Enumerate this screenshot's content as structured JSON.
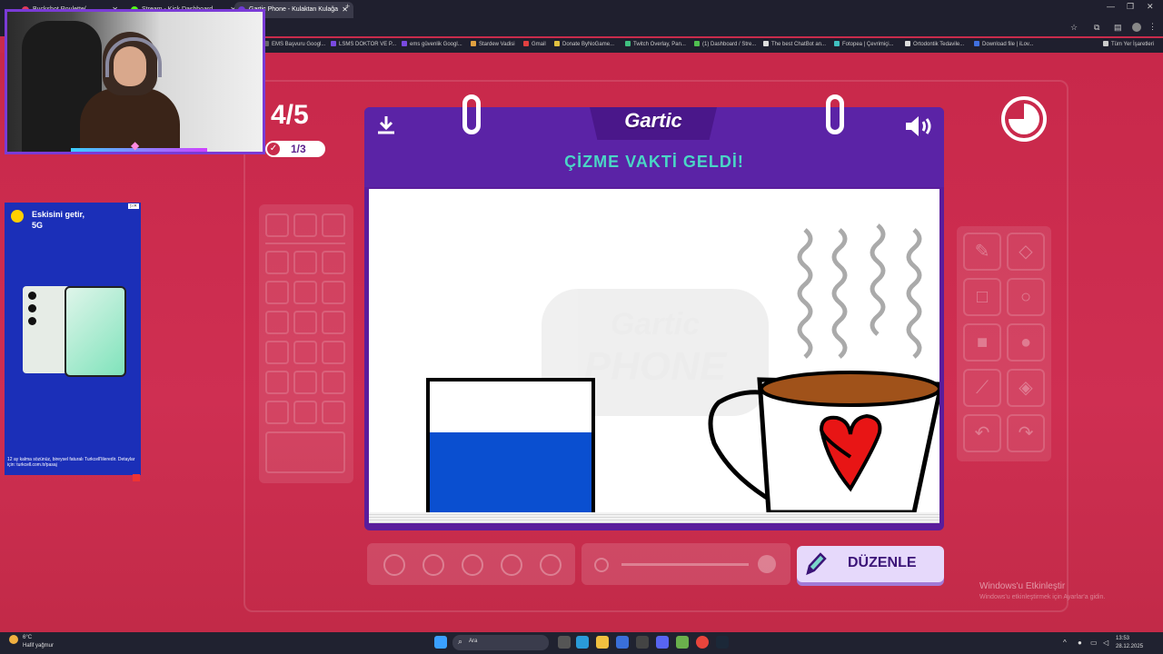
{
  "browser": {
    "tabs": [
      {
        "label": "Buckshot Roulette(...",
        "color": "#e03a5c"
      },
      {
        "label": "Stream - Kick Dashboard",
        "color": "#53fc18"
      },
      {
        "label": "Gartic Phone - Kulaktan Kulağa",
        "color": "#6f3bd6",
        "active": true
      }
    ],
    "new_tab": "+",
    "bookmarks": [
      "EMS Başvuru Googl...",
      "LSMS DOKTOR VE P...",
      "ems güvenlik Googl...",
      "Stardew Vadisi",
      "Gmail",
      "Donate ByNoGame...",
      "Twitch Overlay, Pan...",
      "(1) Dashboard / Stre...",
      "The best ChatBot an...",
      "Fotopea | Çevrimiçi...",
      "Ortodontik Tedavile...",
      "Download file | iLov...",
      "Tüm Yer İşaretleri"
    ]
  },
  "ad": {
    "headline_1": "Eskisini getir,",
    "headline_2": "5G",
    "fine_print": "12 ay kalma sözünüz, bireysel faturalı Turkcell'lileredir. Detaylar için: turkcell.com.tr/pasaj"
  },
  "game": {
    "round": "4/5",
    "done_count": "1/3",
    "logo": "Gartic",
    "title": "ÇİZME VAKTİ GELDİ!",
    "edit_button": "DÜZENLE",
    "watermark": "Gartic PHONE"
  },
  "windows": {
    "activate_title": "Windows'u Etkinleştir",
    "activate_sub": "Windows'u etkinleştirmek için Ayarlar'a gidin."
  },
  "taskbar": {
    "weather_temp": "6°C",
    "weather_desc": "Hafif yağmur",
    "search_placeholder": "Ara",
    "time": "13:53",
    "date": "28.12.2025"
  }
}
